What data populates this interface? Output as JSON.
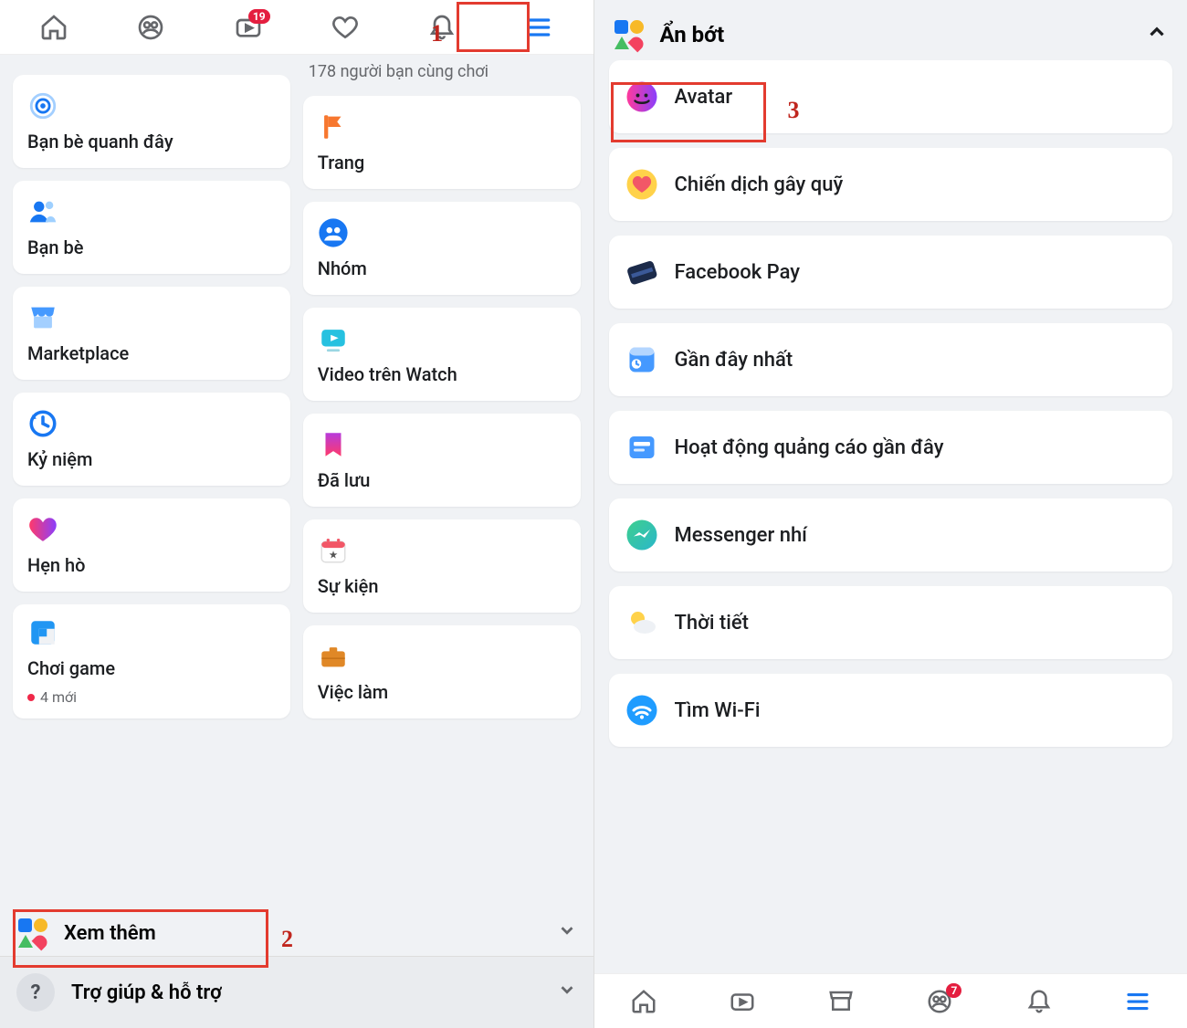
{
  "annotations": {
    "step1": "1",
    "step2": "2",
    "step3": "3"
  },
  "left": {
    "topnav": {
      "watch_badge": "19"
    },
    "friends_also": "178 người bạn cùng chơi",
    "cards_left": [
      {
        "id": "nearby-friends",
        "label": "Bạn bè quanh đây"
      },
      {
        "id": "friends",
        "label": "Bạn bè"
      },
      {
        "id": "marketplace",
        "label": "Marketplace"
      },
      {
        "id": "memories",
        "label": "Kỷ niệm"
      },
      {
        "id": "dating",
        "label": "Hẹn hò"
      },
      {
        "id": "gaming",
        "label": "Chơi game",
        "sub": "4 mới"
      }
    ],
    "cards_right": [
      {
        "id": "pages",
        "label": "Trang"
      },
      {
        "id": "groups",
        "label": "Nhóm"
      },
      {
        "id": "watch",
        "label": "Video trên Watch"
      },
      {
        "id": "saved",
        "label": "Đã lưu"
      },
      {
        "id": "events",
        "label": "Sự kiện"
      },
      {
        "id": "jobs",
        "label": "Việc làm"
      }
    ],
    "see_more": "Xem thêm",
    "help": "Trợ giúp & hỗ trợ"
  },
  "right": {
    "header": "Ẩn bớt",
    "items": [
      {
        "id": "avatar",
        "label": "Avatar"
      },
      {
        "id": "fundraisers",
        "label": "Chiến dịch gây quỹ"
      },
      {
        "id": "facebook-pay",
        "label": "Facebook Pay"
      },
      {
        "id": "most-recent",
        "label": "Gần đây nhất"
      },
      {
        "id": "recent-ads",
        "label": "Hoạt động quảng cáo gần đây"
      },
      {
        "id": "messenger-kids",
        "label": "Messenger nhí"
      },
      {
        "id": "weather",
        "label": "Thời tiết"
      },
      {
        "id": "find-wifi",
        "label": "Tìm Wi-Fi"
      }
    ],
    "bottomnav": {
      "groups_badge": "7"
    }
  }
}
